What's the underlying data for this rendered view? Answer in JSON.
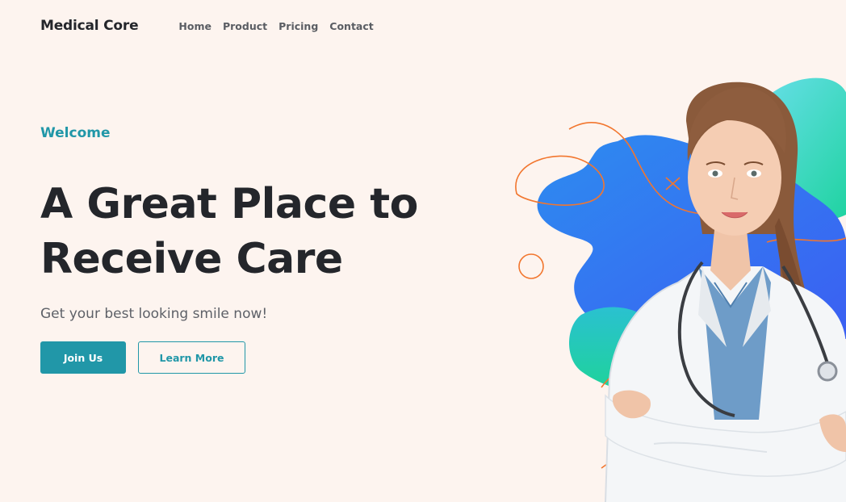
{
  "header": {
    "logo": "Medical Core",
    "nav": [
      "Home",
      "Product",
      "Pricing",
      "Contact"
    ]
  },
  "hero": {
    "eyebrow": "Welcome",
    "headline_line1": "A Great Place to",
    "headline_line2": "Receive Care",
    "tagline": "Get your best looking smile now!",
    "primary_button": "Join Us",
    "secondary_button": "Learn More"
  },
  "colors": {
    "background": "#fdf4ef",
    "accent": "#2197a8",
    "text": "#24262b",
    "blob_blue": "#2f6ff2",
    "blob_teal": "#3ad0c0",
    "scribble": "#f2762e"
  }
}
